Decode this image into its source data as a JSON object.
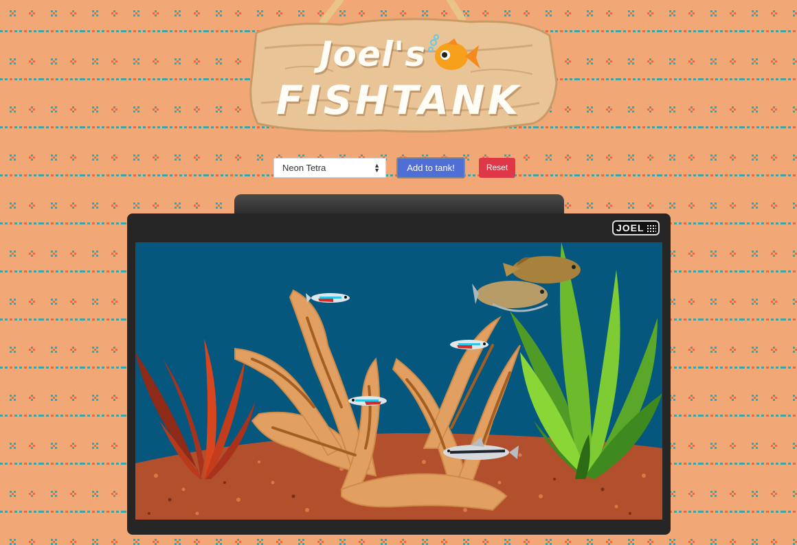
{
  "sign": {
    "title_line1": "Joel's",
    "title_line2": "FISHTANK"
  },
  "controls": {
    "fish_select": {
      "selected": "Neon Tetra",
      "caret_icon": "updown-caret-icon"
    },
    "add_button": "Add to tank!",
    "reset_button": "Reset"
  },
  "tank": {
    "brand": "JOEL",
    "fish": [
      "neon-tetra",
      "neon-tetra",
      "neon-tetra",
      "gourami",
      "gourami",
      "cory-catfish"
    ],
    "plants": [
      "red-plant",
      "green-plant",
      "driftwood"
    ]
  },
  "colors": {
    "background": "#f2a876",
    "water": "#05577e",
    "add_button": "#4f6fd6",
    "reset_button": "#dd3748",
    "tank_frame": "#262626",
    "gravel": "#b24f2c"
  }
}
